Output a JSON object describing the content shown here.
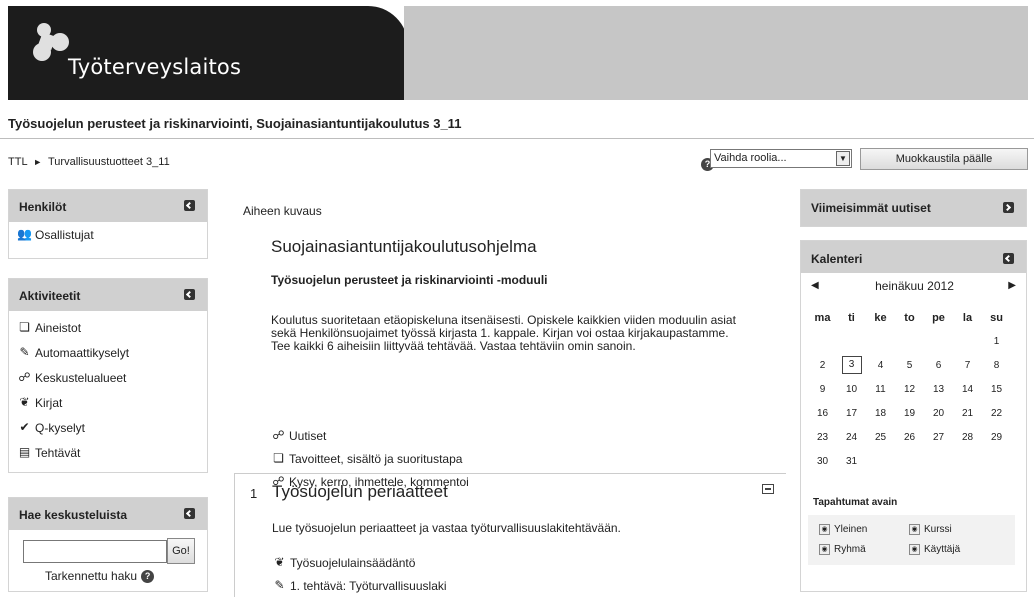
{
  "header": {
    "logo_text": "Työterveyslaitos"
  },
  "course_title": "Työsuojelun perusteet ja riskinarviointi, Suojainasiantuntijakoulutus 3_11",
  "breadcrumb": {
    "root": "TTL",
    "separator": "►",
    "current": "Turvallisuustuotteet 3_11"
  },
  "navbar": {
    "role_select_value": "Vaihda roolia...",
    "edit_button": "Muokkaustila päälle"
  },
  "blocks": {
    "henkilot": {
      "title": "Henkilöt",
      "items": [
        {
          "label": "Osallistujat",
          "icon": "participants-icon"
        }
      ]
    },
    "aktiviteetit": {
      "title": "Aktiviteetit",
      "items": [
        {
          "label": "Aineistot",
          "icon": "resources-icon"
        },
        {
          "label": "Automaattikyselyt",
          "icon": "survey-icon"
        },
        {
          "label": "Keskustelualueet",
          "icon": "forum-icon"
        },
        {
          "label": "Kirjat",
          "icon": "book-icon"
        },
        {
          "label": "Q-kyselyt",
          "icon": "questionnaire-icon"
        },
        {
          "label": "Tehtävät",
          "icon": "assignment-icon"
        }
      ]
    },
    "hae": {
      "title": "Hae keskusteluista",
      "button": "Go!",
      "advanced": "Tarkennettu haku"
    },
    "uutiset": {
      "title": "Viimeisimmät uutiset"
    },
    "kalenteri": {
      "title": "Kalenteri",
      "month": "heinäkuu 2012",
      "weekdays": [
        "ma",
        "ti",
        "ke",
        "to",
        "pe",
        "la",
        "su"
      ],
      "weeks": [
        [
          "",
          "",
          "",
          "",
          "",
          "",
          "1"
        ],
        [
          "2",
          "3",
          "4",
          "5",
          "6",
          "7",
          "8"
        ],
        [
          "9",
          "10",
          "11",
          "12",
          "13",
          "14",
          "15"
        ],
        [
          "16",
          "17",
          "18",
          "19",
          "20",
          "21",
          "22"
        ],
        [
          "23",
          "24",
          "25",
          "26",
          "27",
          "28",
          "29"
        ],
        [
          "30",
          "31",
          "",
          "",
          "",
          "",
          ""
        ]
      ],
      "today": "3",
      "legend_title": "Tapahtumat avain",
      "legend": {
        "yleinen": "Yleinen",
        "kurssi": "Kurssi",
        "ryhma": "Ryhmä",
        "kayttaja": "Käyttäjä"
      }
    }
  },
  "main": {
    "topic_label": "Aiheen kuvaus",
    "heading": "Suojainasiantuntijakoulutusohjelma",
    "module": "Työsuojelun perusteet ja riskinarviointi -moduuli",
    "intro": "Koulutus suoritetaan etäopiskeluna itsenäisesti. Opiskele kaikkien viiden moduulin asiat sekä Henkilönsuojaimet työssä kirjasta 1. kappale. Kirjan voi ostaa kirjakaupastamme. Tee kaikki 6 aiheisiin liittyvää tehtävää. Vastaa tehtäviin omin sanoin.",
    "resources": [
      {
        "label": "Uutiset",
        "icon": "forum-icon"
      },
      {
        "label": "Tavoitteet, sisältö ja suoritustapa",
        "icon": "resource-icon"
      },
      {
        "label": "Kysy, kerro, ihmettele, kommentoi",
        "icon": "forum-icon"
      }
    ],
    "section1": {
      "number": "1",
      "title": "Työsuojelun periaatteet",
      "description": "Lue työsuojelun periaatteet ja vastaa työturvallisuuslakitehtävään.",
      "items": [
        {
          "label": "Työsuojelulainsäädäntö",
          "icon": "book-icon"
        },
        {
          "label": "1. tehtävä: Työturvallisuuslaki",
          "icon": "assignment-icon"
        }
      ]
    }
  }
}
